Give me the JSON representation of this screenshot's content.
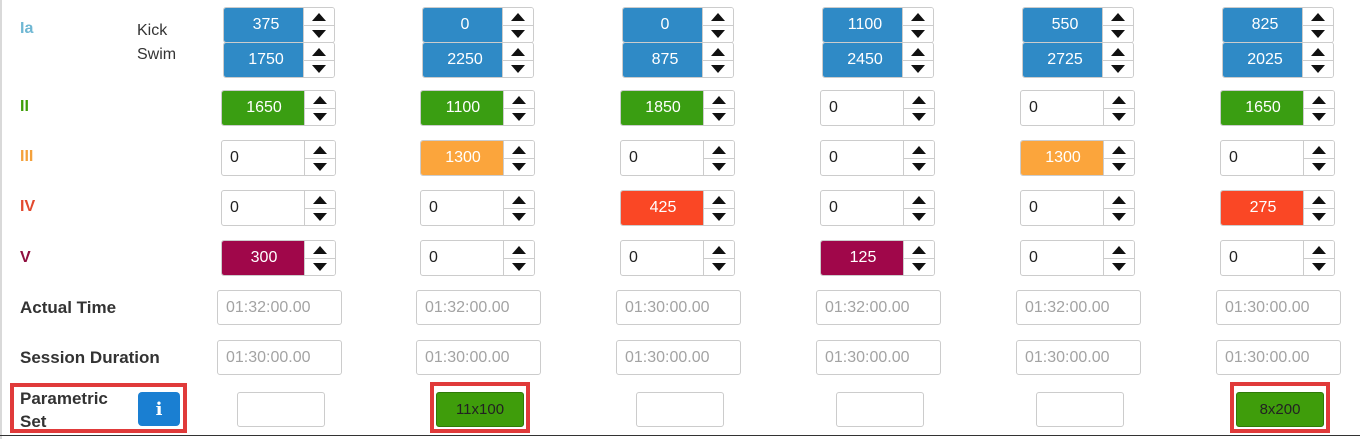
{
  "colors": {
    "zone_ia": "#6fb7d3",
    "zone_ii": "#3e9e07",
    "zone_iii": "#f4a13b",
    "zone_iv": "#e2492e",
    "zone_v": "#8f0e3f",
    "fill_blue": "#2f8ac6",
    "fill_green": "#3a9e12",
    "fill_orange": "#fba53c",
    "fill_red": "#fa4725",
    "fill_maroon": "#a0074a",
    "param_green": "#3f9d0b",
    "info_button": "#1a7fd2",
    "highlight_red": "#e03a3a"
  },
  "zones": {
    "ia": "Ia",
    "ii": "II",
    "iii": "III",
    "iv": "IV",
    "v": "V"
  },
  "ia_sublabels": {
    "kick": "Kick",
    "swim": "Swim"
  },
  "labels": {
    "actual_time": "Actual Time",
    "session_duration": "Session Duration",
    "parametric_set": "Parametric Set"
  },
  "info_icon": {
    "glyph": "i",
    "icon": "info-icon"
  },
  "columns": [
    {
      "kick": "375",
      "swim": "1750",
      "ii": "1650",
      "iii": "0",
      "iv": "0",
      "v": "300",
      "actual_time": "01:32:00.00",
      "session_duration": "01:30:00.00",
      "parametric_set": ""
    },
    {
      "kick": "0",
      "swim": "2250",
      "ii": "1100",
      "iii": "1300",
      "iv": "0",
      "v": "0",
      "actual_time": "01:32:00.00",
      "session_duration": "01:30:00.00",
      "parametric_set": "11x100"
    },
    {
      "kick": "0",
      "swim": "875",
      "ii": "1850",
      "iii": "0",
      "iv": "425",
      "v": "0",
      "actual_time": "01:30:00.00",
      "session_duration": "01:30:00.00",
      "parametric_set": ""
    },
    {
      "kick": "1100",
      "swim": "2450",
      "ii": "0",
      "iii": "0",
      "iv": "0",
      "v": "125",
      "actual_time": "01:32:00.00",
      "session_duration": "01:30:00.00",
      "parametric_set": ""
    },
    {
      "kick": "550",
      "swim": "2725",
      "ii": "0",
      "iii": "1300",
      "iv": "0",
      "v": "0",
      "actual_time": "01:32:00.00",
      "session_duration": "01:30:00.00",
      "parametric_set": ""
    },
    {
      "kick": "825",
      "swim": "2025",
      "ii": "1650",
      "iii": "0",
      "iv": "275",
      "v": "0",
      "actual_time": "01:30:00.00",
      "session_duration": "01:30:00.00",
      "parametric_set": "8x200"
    }
  ]
}
